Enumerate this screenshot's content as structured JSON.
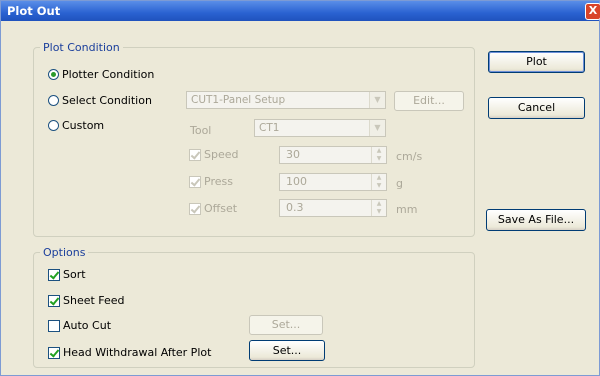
{
  "window": {
    "title": "Plot Out",
    "close_glyph": "X"
  },
  "plot_condition": {
    "legend": "Plot Condition",
    "radio_plotter": "Plotter Condition",
    "radio_select": "Select Condition",
    "radio_custom": "Custom",
    "selected": "plotter",
    "select_combo_value": "CUT1-Panel Setup",
    "edit_button": "Edit...",
    "tool_label": "Tool",
    "tool_value": "CT1",
    "speed_label": "Speed",
    "speed_value": "30",
    "speed_unit": "cm/s",
    "press_label": "Press",
    "press_value": "100",
    "press_unit": "g",
    "offset_label": "Offset",
    "offset_value": "0.3",
    "offset_unit": "mm"
  },
  "options": {
    "legend": "Options",
    "sort_label": "Sort",
    "sheet_feed_label": "Sheet Feed",
    "auto_cut_label": "Auto Cut",
    "auto_cut_set": "Set...",
    "head_withdrawal_label": "Head Withdrawal After Plot",
    "head_withdrawal_set": "Set...",
    "checked": {
      "sort": true,
      "sheet_feed": true,
      "auto_cut": false,
      "head_withdrawal": true
    }
  },
  "buttons": {
    "plot": "Plot",
    "cancel": "Cancel",
    "save_as_file": "Save As File..."
  }
}
